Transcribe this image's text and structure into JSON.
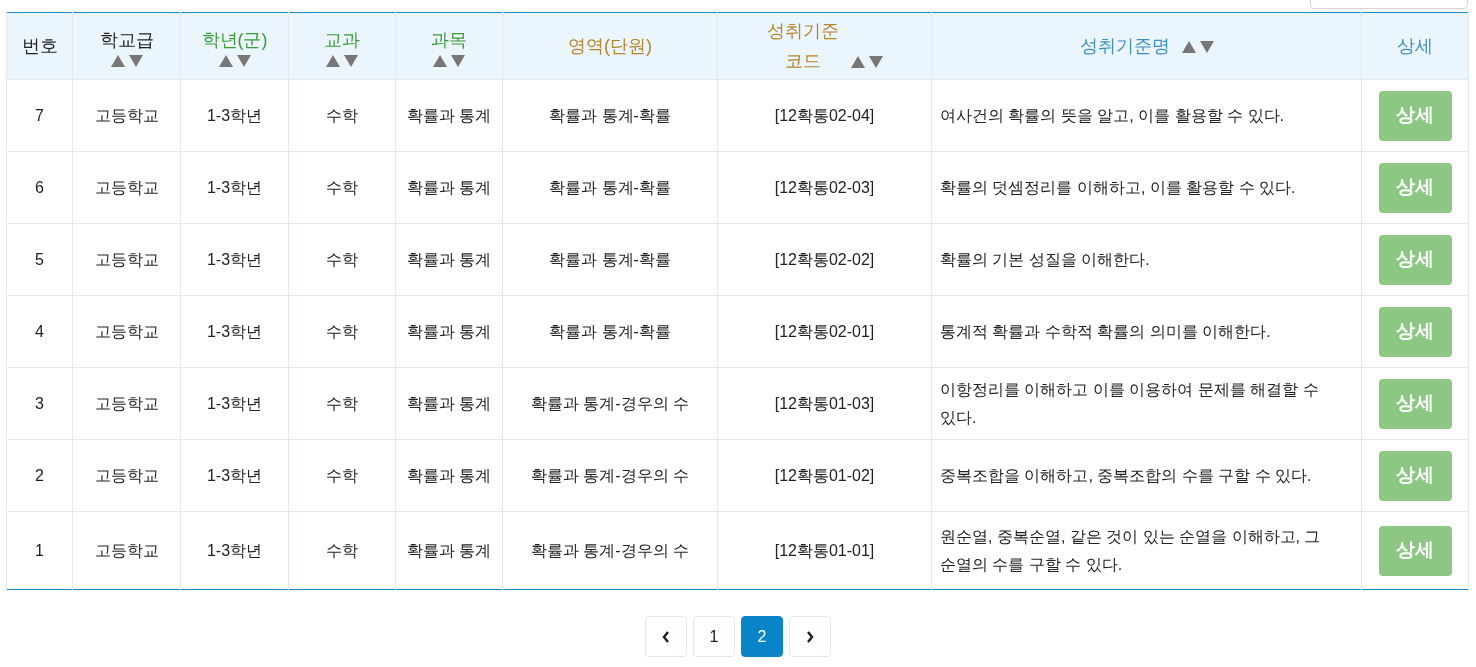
{
  "columns": [
    {
      "label": "번호",
      "color": "#222222",
      "kind": "plain"
    },
    {
      "label": "학교급",
      "color": "#222222",
      "kind": "stacked"
    },
    {
      "label": "학년(군)",
      "color": "#3a9a3a",
      "kind": "stacked"
    },
    {
      "label": "교과",
      "color": "#3a9a3a",
      "kind": "stacked"
    },
    {
      "label": "과목",
      "color": "#3a9a3a",
      "kind": "stacked"
    },
    {
      "label": "영역(단원)",
      "color": "#b5862a",
      "kind": "plain"
    },
    {
      "label": "성취기준\n코드",
      "color": "#b5862a",
      "kind": "inline"
    },
    {
      "label": "성취기준명",
      "color": "#3d8fbf",
      "kind": "inline"
    },
    {
      "label": "상세",
      "color": "#3d8fbf",
      "kind": "plain"
    }
  ],
  "rows": [
    {
      "cells": [
        "7",
        "고등학교",
        "1-3학년",
        "수학",
        "확률과 통계",
        "확률과 통계-확률",
        "[12확통02-04]",
        "여사건의 확률의 뜻을 알고, 이를 활용할 수 있다."
      ],
      "button": "상세"
    },
    {
      "cells": [
        "6",
        "고등학교",
        "1-3학년",
        "수학",
        "확률과 통계",
        "확률과 통계-확률",
        "[12확통02-03]",
        "확률의 덧셈정리를 이해하고, 이를 활용할 수 있다."
      ],
      "button": "상세"
    },
    {
      "cells": [
        "5",
        "고등학교",
        "1-3학년",
        "수학",
        "확률과 통계",
        "확률과 통계-확률",
        "[12확통02-02]",
        "확률의 기본 성질을 이해한다."
      ],
      "button": "상세"
    },
    {
      "cells": [
        "4",
        "고등학교",
        "1-3학년",
        "수학",
        "확률과 통계",
        "확률과 통계-확률",
        "[12확통02-01]",
        "통계적 확률과 수학적 확률의 의미를 이해한다."
      ],
      "button": "상세"
    },
    {
      "cells": [
        "3",
        "고등학교",
        "1-3학년",
        "수학",
        "확률과 통계",
        "확률과 통계-경우의 수",
        "[12확통01-03]",
        "이항정리를 이해하고 이를 이용하여 문제를 해결할 수 있다."
      ],
      "button": "상세"
    },
    {
      "cells": [
        "2",
        "고등학교",
        "1-3학년",
        "수학",
        "확률과 통계",
        "확률과 통계-경우의 수",
        "[12확통01-02]",
        "중복조합을 이해하고, 중복조합의 수를 구할 수 있다."
      ],
      "button": "상세"
    },
    {
      "cells": [
        "1",
        "고등학교",
        "1-3학년",
        "수학",
        "확률과 통계",
        "확률과 통계-경우의 수",
        "[12확통01-01]",
        "원순열, 중복순열, 같은 것이 있는 순열을 이해하고, 그 순열의 수를 구할 수 있다."
      ],
      "button": "상세"
    }
  ],
  "pagination": {
    "pages": [
      {
        "label": "1",
        "selected": false
      },
      {
        "label": "2",
        "selected": true
      }
    ]
  }
}
